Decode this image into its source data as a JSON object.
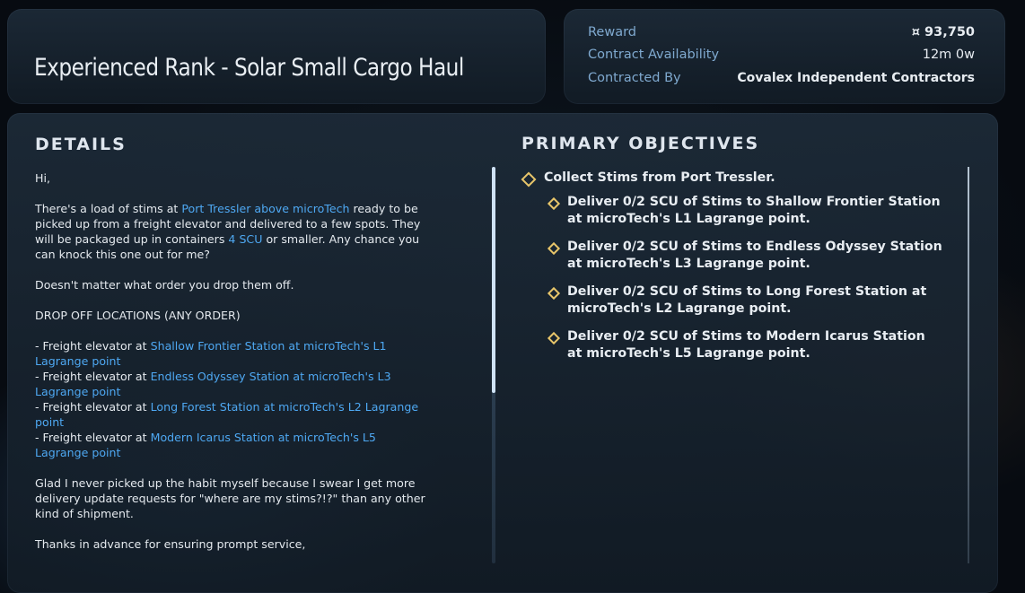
{
  "title": "Experienced Rank - Solar Small Cargo Haul",
  "info": {
    "reward_label": "Reward",
    "reward_value": "¤ 93,750",
    "availability_label": "Contract Availability",
    "availability_value": "12m 0w",
    "contracted_label": "Contracted By",
    "contracted_value": "Covalex Independent Contractors"
  },
  "details": {
    "heading": "DETAILS",
    "greeting": "Hi,",
    "p1_a": "There's a load of stims at ",
    "p1_link1": "Port Tressler above microTech",
    "p1_b": " ready to be picked up from a freight elevator and delivered to a few spots. They will be packaged up in containers ",
    "p1_link2": "4 SCU",
    "p1_c": " or smaller. Any chance you can knock this one out for me?",
    "p2": "Doesn't matter what order you drop them off.",
    "dropoff_heading": "DROP OFF LOCATIONS (ANY ORDER)",
    "dropoff_prefix": "- Freight elevator at ",
    "dropoffs": [
      "Shallow Frontier Station at microTech's L1 Lagrange point",
      "Endless Odyssey Station at microTech's L3 Lagrange point",
      "Long Forest Station at microTech's L2 Lagrange point",
      "Modern Icarus Station at microTech's L5 Lagrange point"
    ],
    "p3": "Glad I never picked up the habit myself because I swear I get more delivery update requests for \"where are my stims?!?\" than any other kind of shipment.",
    "p4": "Thanks in advance for ensuring prompt service,"
  },
  "objectives": {
    "heading": "PRIMARY OBJECTIVES",
    "main": "Collect Stims from Port Tressler.",
    "subs": [
      "Deliver 0/2 SCU of Stims to Shallow Frontier Station at microTech's L1 Lagrange point.",
      "Deliver 0/2 SCU of Stims to Endless Odyssey Station at microTech's L3 Lagrange point.",
      "Deliver 0/2 SCU of Stims to Long Forest Station at microTech's L2 Lagrange point.",
      "Deliver 0/2 SCU of Stims to Modern Icarus Station at microTech's L5 Lagrange point."
    ]
  },
  "colors": {
    "accent_link": "#4ea8f2",
    "objective_marker": "#e7c56a",
    "label_blue": "#7fa9cf"
  }
}
